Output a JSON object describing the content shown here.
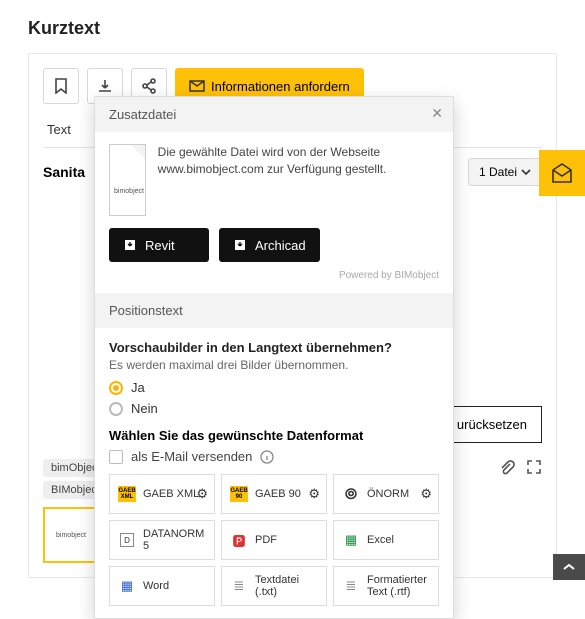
{
  "header": {
    "title": "Kurztext"
  },
  "toolbar": {
    "request_label": "Informationen anfordern"
  },
  "tabs": {
    "text": "Text"
  },
  "row2": {
    "title": "Sanita",
    "file_label": "1 Datei"
  },
  "reset_label": "urücksetzen",
  "chips": {
    "bimobject": "bimObject",
    "bimobj": "BIMobject"
  },
  "thumb_label": "bimobject",
  "modal": {
    "zusatz_title": "Zusatzdatei",
    "file_text": "Die gewählte Datei wird von der Webseite www.bimobject.com zur Verfügung gestellt.",
    "revit": "Revit",
    "archicad": "Archicad",
    "powered": "Powered by BIMobject",
    "pos_title": "Positionstext",
    "q1": "Vorschaubilder in den Langtext übernehmen?",
    "q1_sub": "Es werden maximal drei Bilder übernommen.",
    "opt_yes": "Ja",
    "opt_no": "Nein",
    "fmt_title": "Wählen Sie das gewünschte Datenformat",
    "email_label": "als E-Mail versenden",
    "formats": {
      "gaebxml": "GAEB XML",
      "gaeb90": "GAEB 90",
      "onorm": "ÖNORM",
      "datanorm": "DATANORM 5",
      "pdf": "PDF",
      "excel": "Excel",
      "word": "Word",
      "txt": "Textdatei (.txt)",
      "rtf": "Formatierter Text (.rtf)"
    }
  }
}
